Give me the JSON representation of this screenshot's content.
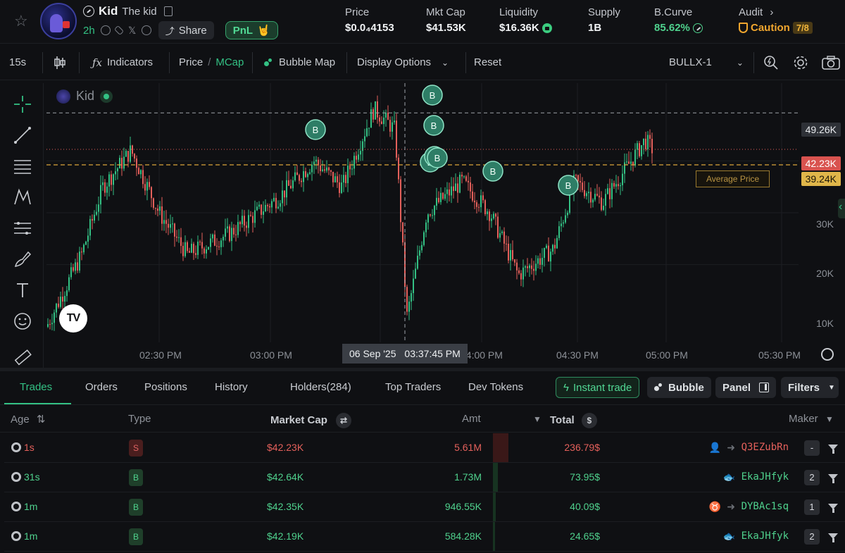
{
  "token": {
    "symbol": "Kid",
    "name": "The kid",
    "age": "2h",
    "share_label": "Share",
    "pnl_label": "PnL",
    "pnl_emoji": "🤘"
  },
  "stats": {
    "price_label": "Price",
    "price_value": "$0.0₄4153",
    "mcap_label": "Mkt Cap",
    "mcap_value": "$41.53K",
    "liquidity_label": "Liquidity",
    "liquidity_value": "$16.36K",
    "supply_label": "Supply",
    "supply_value": "1B",
    "bcurve_label": "B.Curve",
    "bcurve_value": "85.62%",
    "audit_label": "Audit",
    "audit_value": "Caution",
    "audit_score": "7/8"
  },
  "toolbar": {
    "interval": "15s",
    "indicators": "Indicators",
    "price": "Price",
    "slash": "/",
    "mcap": "MCap",
    "bubble_map": "Bubble Map",
    "display_options": "Display Options",
    "reset": "Reset",
    "source": "BULLX-1"
  },
  "chart": {
    "legend_symbol": "Kid",
    "logo_text": "TV",
    "y_labels": [
      "49.26K",
      "42.23K",
      "39.24K",
      "30K",
      "20K",
      "10K"
    ],
    "x_labels": [
      "02:30 PM",
      "03:00 PM",
      "04:00 PM",
      "04:30 PM",
      "05:00 PM",
      "05:30 PM"
    ],
    "crosshair_date": "06 Sep '25",
    "crosshair_time": "03:37:45 PM",
    "avg_price_label": "Average Price",
    "buy_marker_label": "B",
    "colors": {
      "up": "#33c184",
      "down": "#e4605b",
      "avg": "#d9a53a",
      "crosshair_tag": "#3a3e45"
    },
    "ylim": [
      5000,
      55000
    ],
    "reference_lines": {
      "crosshair_level": 49260,
      "last_price": 42230,
      "average_price": 39240
    }
  },
  "tabs": [
    "Trades",
    "Orders",
    "Positions",
    "History",
    "Holders(284)",
    "Top Traders",
    "Dev Tokens"
  ],
  "actions": {
    "instant_trade": "Instant trade",
    "bubble": "Bubble",
    "panel": "Panel",
    "filters": "Filters"
  },
  "table": {
    "headers": {
      "age": "Age",
      "type": "Type",
      "market_cap": "Market Cap",
      "amt": "Amt",
      "total": "Total",
      "maker": "Maker"
    },
    "rows": [
      {
        "age": "1s",
        "type": "S",
        "mcap": "$42.23K",
        "amt": "5.61M",
        "total": "236.79$",
        "maker": "Q3EZubRn",
        "count": "-",
        "side": "sell",
        "volume_fraction": 1.0
      },
      {
        "age": "31s",
        "type": "B",
        "mcap": "$42.64K",
        "amt": "1.73M",
        "total": "73.95$",
        "maker": "EkaJHfyk",
        "count": "2",
        "side": "buy",
        "volume_fraction": 0.31
      },
      {
        "age": "1m",
        "type": "B",
        "mcap": "$42.35K",
        "amt": "946.55K",
        "total": "40.09$",
        "maker": "DYBAc1sq",
        "count": "1",
        "side": "buy",
        "volume_fraction": 0.17
      },
      {
        "age": "1m",
        "type": "B",
        "mcap": "$42.19K",
        "amt": "584.28K",
        "total": "24.65$",
        "maker": "EkaJHfyk",
        "count": "2",
        "side": "buy",
        "volume_fraction": 0.1
      }
    ]
  }
}
